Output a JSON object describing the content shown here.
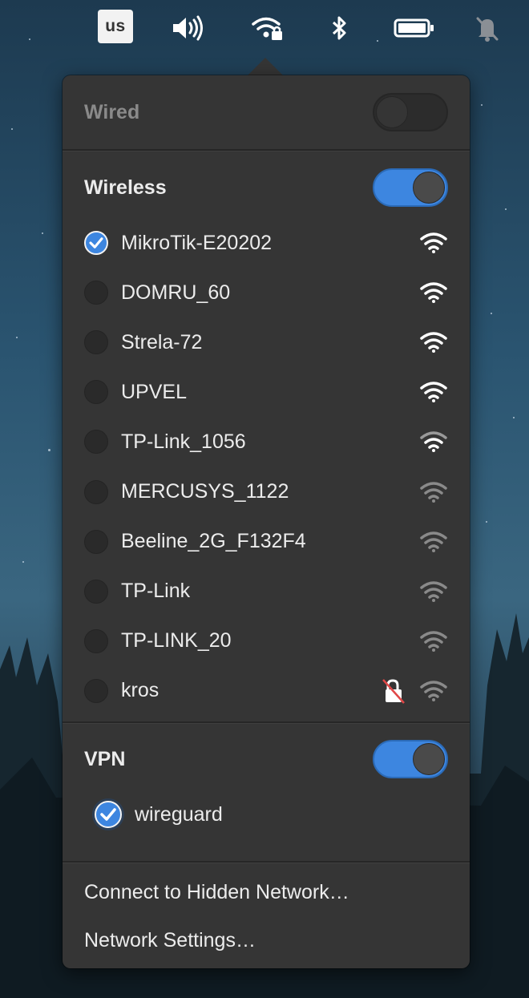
{
  "topbar": {
    "keyboard_layout": "us",
    "icons": [
      "volume-icon",
      "wifi-locked-icon",
      "bluetooth-icon",
      "battery-icon",
      "notifications-muted-icon"
    ]
  },
  "wired": {
    "label": "Wired",
    "enabled": false
  },
  "wireless": {
    "label": "Wireless",
    "enabled": true,
    "networks": [
      {
        "name": "MikroTik-E20202",
        "connected": true,
        "signal": "strong"
      },
      {
        "name": "DOMRU_60",
        "connected": false,
        "signal": "strong"
      },
      {
        "name": "Strela-72",
        "connected": false,
        "signal": "strong"
      },
      {
        "name": "UPVEL",
        "connected": false,
        "signal": "strong"
      },
      {
        "name": "TP-Link_1056",
        "connected": false,
        "signal": "medium"
      },
      {
        "name": "MERCUSYS_1122",
        "connected": false,
        "signal": "weak"
      },
      {
        "name": "Beeline_2G_F132F4",
        "connected": false,
        "signal": "weak"
      },
      {
        "name": "TP-Link",
        "connected": false,
        "signal": "weak"
      },
      {
        "name": "TP-LINK_20",
        "connected": false,
        "signal": "weak"
      },
      {
        "name": "kros",
        "connected": false,
        "signal": "weak",
        "insecure": true
      }
    ]
  },
  "vpn": {
    "label": "VPN",
    "enabled": true,
    "connections": [
      {
        "name": "wireguard",
        "connected": true
      }
    ]
  },
  "menu": {
    "hidden_network": "Connect to Hidden Network…",
    "settings": "Network Settings…"
  },
  "colors": {
    "accent": "#3d86e0",
    "popover_bg": "#353535"
  }
}
